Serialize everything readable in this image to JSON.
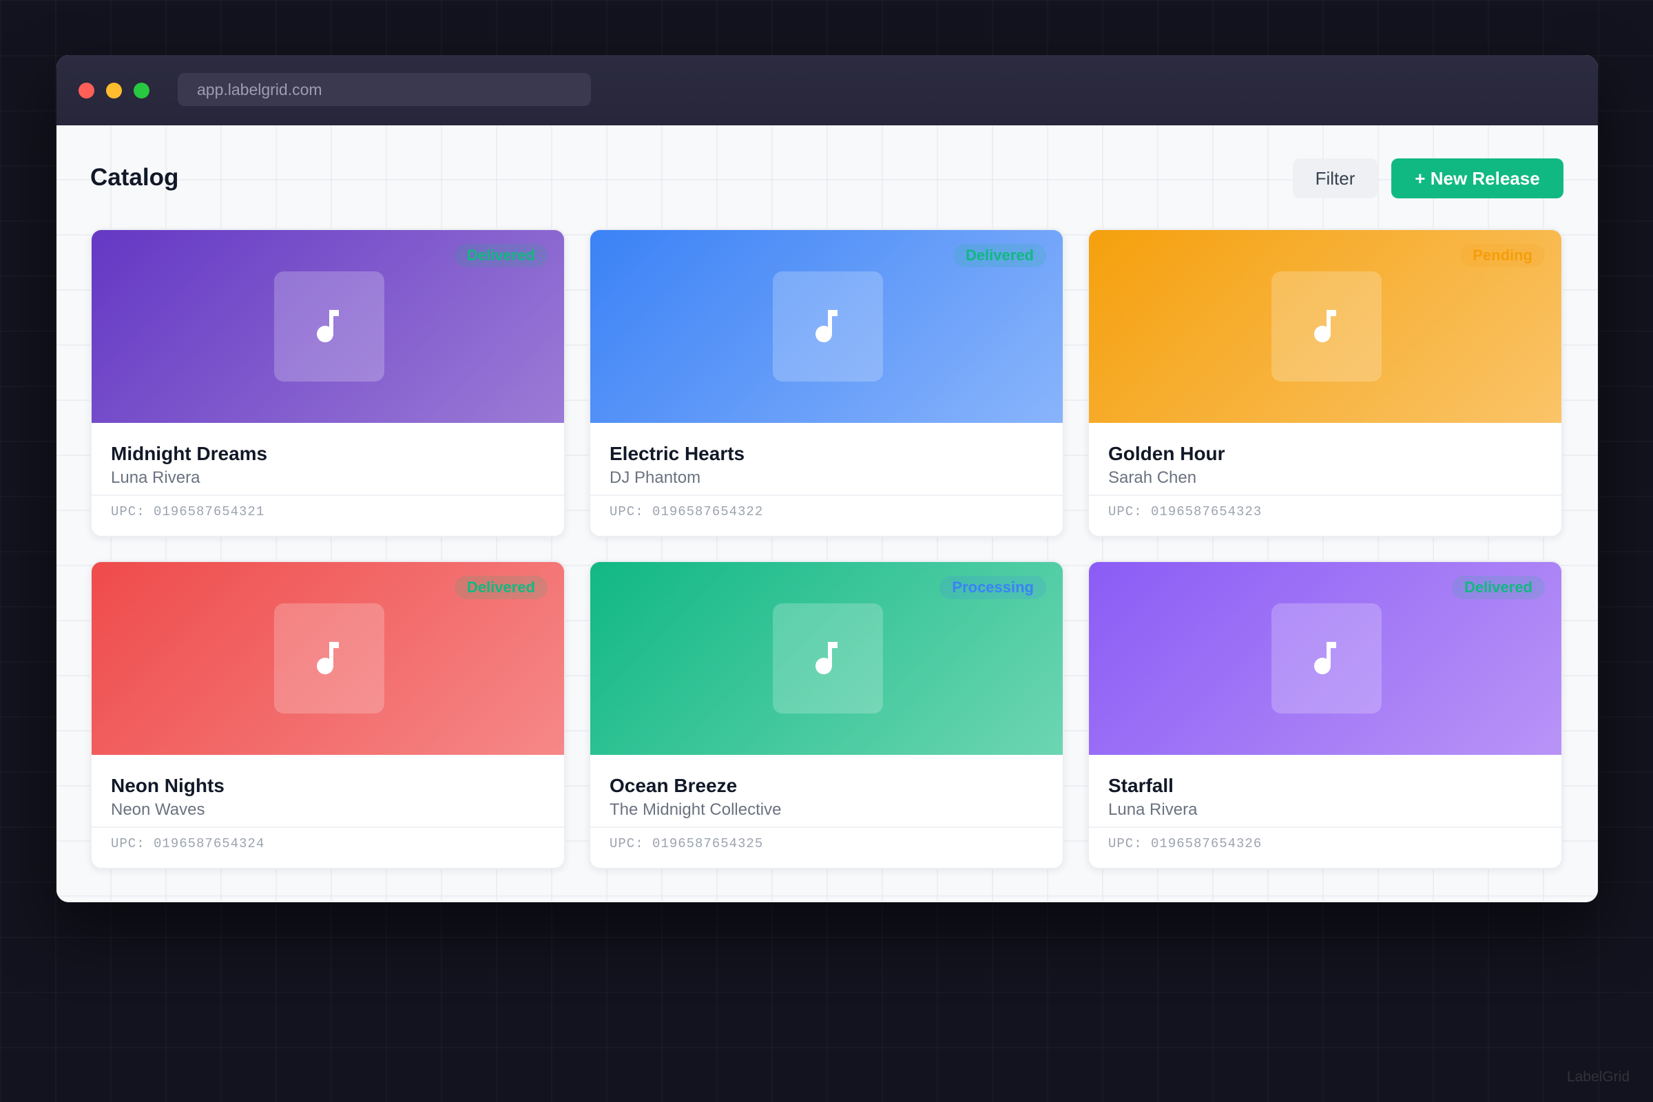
{
  "browser": {
    "url": "app.labelgrid.com"
  },
  "header": {
    "title": "Catalog",
    "filter_label": "Filter",
    "new_release_label": "+ New Release"
  },
  "releases": [
    {
      "title": "Midnight Dreams",
      "artist": "Luna Rivera",
      "upc": "UPC: 0196587654321",
      "status": "Delivered",
      "status_kind": "delivered",
      "cover_colors": [
        "#6438c4",
        "#9b7bd6"
      ]
    },
    {
      "title": "Electric Hearts",
      "artist": "DJ Phantom",
      "upc": "UPC: 0196587654322",
      "status": "Delivered",
      "status_kind": "delivered",
      "cover_colors": [
        "#3b82f6",
        "#89b4fb"
      ]
    },
    {
      "title": "Golden Hour",
      "artist": "Sarah Chen",
      "upc": "UPC: 0196587654323",
      "status": "Pending",
      "status_kind": "pending",
      "cover_colors": [
        "#f5a00d",
        "#fac468"
      ]
    },
    {
      "title": "Neon Nights",
      "artist": "Neon Waves",
      "upc": "UPC: 0196587654324",
      "status": "Delivered",
      "status_kind": "delivered",
      "cover_colors": [
        "#ef4b4b",
        "#f68888"
      ]
    },
    {
      "title": "Ocean Breeze",
      "artist": "The Midnight Collective",
      "upc": "UPC: 0196587654325",
      "status": "Processing",
      "status_kind": "processing",
      "cover_colors": [
        "#11b884",
        "#6dd6b2"
      ]
    },
    {
      "title": "Starfall",
      "artist": "Luna Rivera",
      "upc": "UPC: 0196587654326",
      "status": "Delivered",
      "status_kind": "delivered",
      "cover_colors": [
        "#8b5cf5",
        "#b994f7"
      ]
    }
  ],
  "icons": {
    "cover_art": "music-note-icon"
  },
  "colors": {
    "accent": "#10b981",
    "delivered": "#10b981",
    "pending": "#f59e0b",
    "processing": "#3b82f6"
  },
  "watermark": "LabelGrid"
}
